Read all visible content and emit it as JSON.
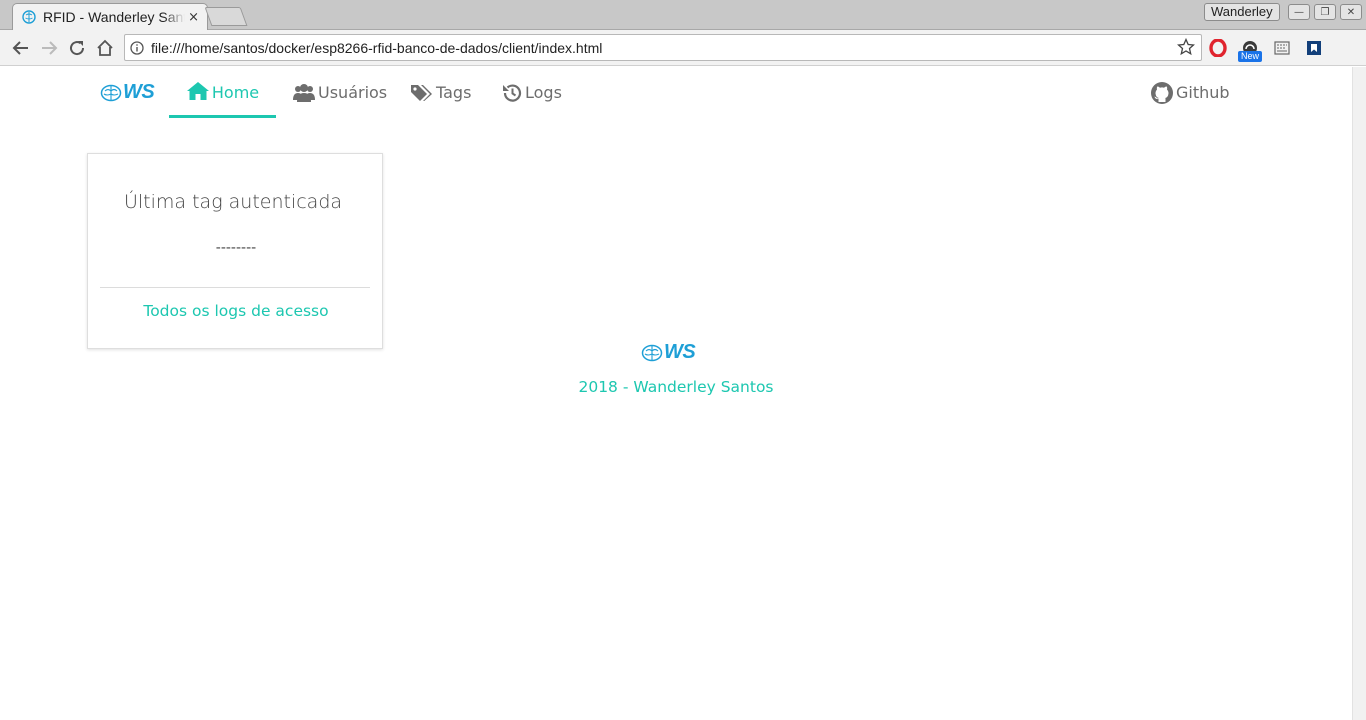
{
  "browser": {
    "tab_title": "RFID - Wanderley Santos",
    "tab_close": "×",
    "profile_name": "Wanderley",
    "url": "file:///home/santos/docker/esp8266-rfid-banco-de-dados/client/index.html",
    "new_badge": "New",
    "window_buttons": [
      "—",
      "❐",
      "✕"
    ],
    "extensions": [
      "opera-icon",
      "new-extension-icon",
      "keyboard-icon",
      "bookmark-app-icon"
    ]
  },
  "site": {
    "brand": "WS",
    "nav": [
      {
        "label": "Home",
        "icon": "home-icon",
        "active": true
      },
      {
        "label": "Usuários",
        "icon": "users-icon",
        "active": false
      },
      {
        "label": "Tags",
        "icon": "tags-icon",
        "active": false
      },
      {
        "label": "Logs",
        "icon": "history-icon",
        "active": false
      }
    ],
    "github": {
      "label": "Github",
      "icon": "github-icon"
    }
  },
  "card": {
    "title": "Última tag autenticada",
    "value": "--------",
    "link": "Todos os logs de acesso"
  },
  "footer": {
    "brand": "WS",
    "text": "2018 - Wanderley Santos"
  },
  "colors": {
    "accent": "#1dc7b0",
    "brand_blue": "#1e9fd6",
    "nav_text": "#6d6d6d"
  }
}
